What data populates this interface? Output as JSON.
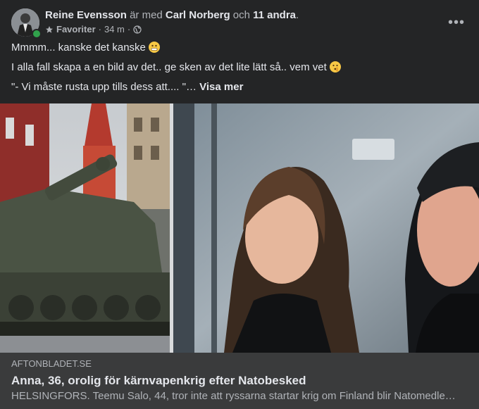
{
  "post": {
    "author": "Reine Evensson",
    "with_text": "är med",
    "tagged": "Carl Norberg",
    "and_text": "och",
    "others": "11 andra",
    "period": ".",
    "audience": "Favoriter",
    "time": "34 m",
    "separator": "·",
    "more_icon": "•••",
    "lines": [
      "Mmmm... kanske det kanske",
      "I alla fall skapa a en bild av det.. ge sken av det lite lätt så.. vem vet",
      "\"- Vi måste rusta upp tills dess att.... \"…"
    ],
    "see_more": "Visa mer"
  },
  "link": {
    "domain": "AFTONBLADET.SE",
    "title": "Anna, 36, orolig för kärnvapenkrig efter Natobesked",
    "description": "HELSINGFORS. Teemu Salo, 44, tror inte att ryssarna startar krig om Finland blir Natomedle…"
  },
  "colors": {
    "background": "#242526",
    "preview_bg": "#3a3b3c",
    "primary_text": "#e4e6eb",
    "secondary_text": "#b0b3b8",
    "online": "#31a24c"
  }
}
